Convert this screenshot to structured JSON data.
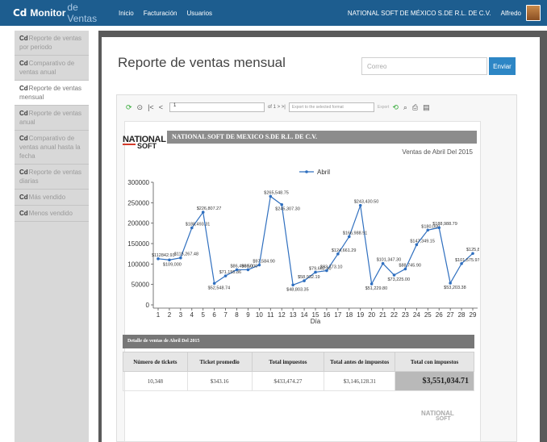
{
  "navbar": {
    "logo": "Cd",
    "brand": "Monitor",
    "brand_suffix": "de Ventas",
    "links": [
      "Inicio",
      "Facturación",
      "Usuarios"
    ],
    "company": "NATIONAL SOFT DE MÉXICO S.DE R.L. DE C.V.",
    "user": "Alfredo"
  },
  "sidebar": {
    "icon": "Cd",
    "items": [
      {
        "label": "Reporte de ventas por periodo"
      },
      {
        "label": "Comparativo de ventas anual"
      },
      {
        "label": "Reporte de ventas mensual"
      },
      {
        "label": "Reporte de ventas anual"
      },
      {
        "label": "Comparativo de ventas anual hasta la fecha"
      },
      {
        "label": "Reporte de ventas diarias"
      },
      {
        "label": "Más vendido"
      },
      {
        "label": "Menos vendido"
      }
    ]
  },
  "main": {
    "title": "Reporte de ventas mensual",
    "email_placeholder": "Correo",
    "send_label": "Enviar"
  },
  "toolbar": {
    "page": "1",
    "pager": "of 1 >  >|",
    "format": "Export to the selected format",
    "export": "Export"
  },
  "report": {
    "logo_top": "NATIONAL",
    "logo_bottom": "SOFT",
    "company": "NATIONAL SOFT DE MEXICO S.DE R.L. DE C.V.",
    "period": "Ventas de Abril Del 2015"
  },
  "chart_data": {
    "type": "line",
    "x": [
      1,
      2,
      3,
      4,
      5,
      6,
      7,
      8,
      9,
      10,
      11,
      12,
      13,
      14,
      15,
      16,
      17,
      18,
      19,
      20,
      21,
      22,
      23,
      24,
      25,
      26,
      27,
      28,
      29
    ],
    "series": [
      {
        "name": "Abril",
        "values": [
          112842,
          110000,
          115000,
          188493.31,
          226807.27,
          52548.74,
          71000,
          86000,
          86000,
          97584.9,
          265548.75,
          245307.3,
          48803.35,
          59000,
          80000,
          83773.1,
          124661.29,
          166988.91,
          243430.5,
          51229.8,
          101347.3,
          73000,
          88000,
          147349.15,
          183000,
          188988.79,
          53203.38,
          101000,
          125841.0
        ],
        "labels": [
          "$112842.93",
          "$109,000",
          "$115,267.48",
          "$188,493.31",
          "$226,807.27",
          "$52,548.74",
          "$71,155.86",
          "$86,496.50",
          "$86,000",
          "$97,584.90",
          "$265,548.75",
          "$245,307.30",
          "$48,803.35",
          "$58,932.19",
          "$79,662.10",
          "$83,773.10",
          "$124,661.29",
          "$166,988.91",
          "$243,430.50",
          "$51,229.80",
          "$101,347.30",
          "$73,225.00",
          "$88,745.90",
          "$147,349.15",
          "$180,000",
          "$188,988.79",
          "$53,203.38",
          "$101,575.97",
          "$125,841.0"
        ]
      }
    ],
    "xlabel": "Día",
    "ylabel": "",
    "ylim": [
      0,
      300000
    ],
    "yticks": [
      0,
      50000,
      100000,
      150000,
      200000,
      250000,
      300000
    ],
    "legend": "top",
    "grid": false,
    "color": "#2f6fbf"
  },
  "detail": {
    "title": "Detalle de ventas de Abril Del 2015",
    "headers": [
      "Número de tickets",
      "Ticket promedio",
      "Total impuestos",
      "Total antes de impuestos",
      "Total con impuestos"
    ],
    "values": [
      "10,348",
      "$343.16",
      "$433,474.27",
      "$3,146,128.31",
      "$3,551,034.71"
    ]
  },
  "footer": {
    "logo_top": "NATIONAL",
    "logo_bottom": "SOFT"
  }
}
